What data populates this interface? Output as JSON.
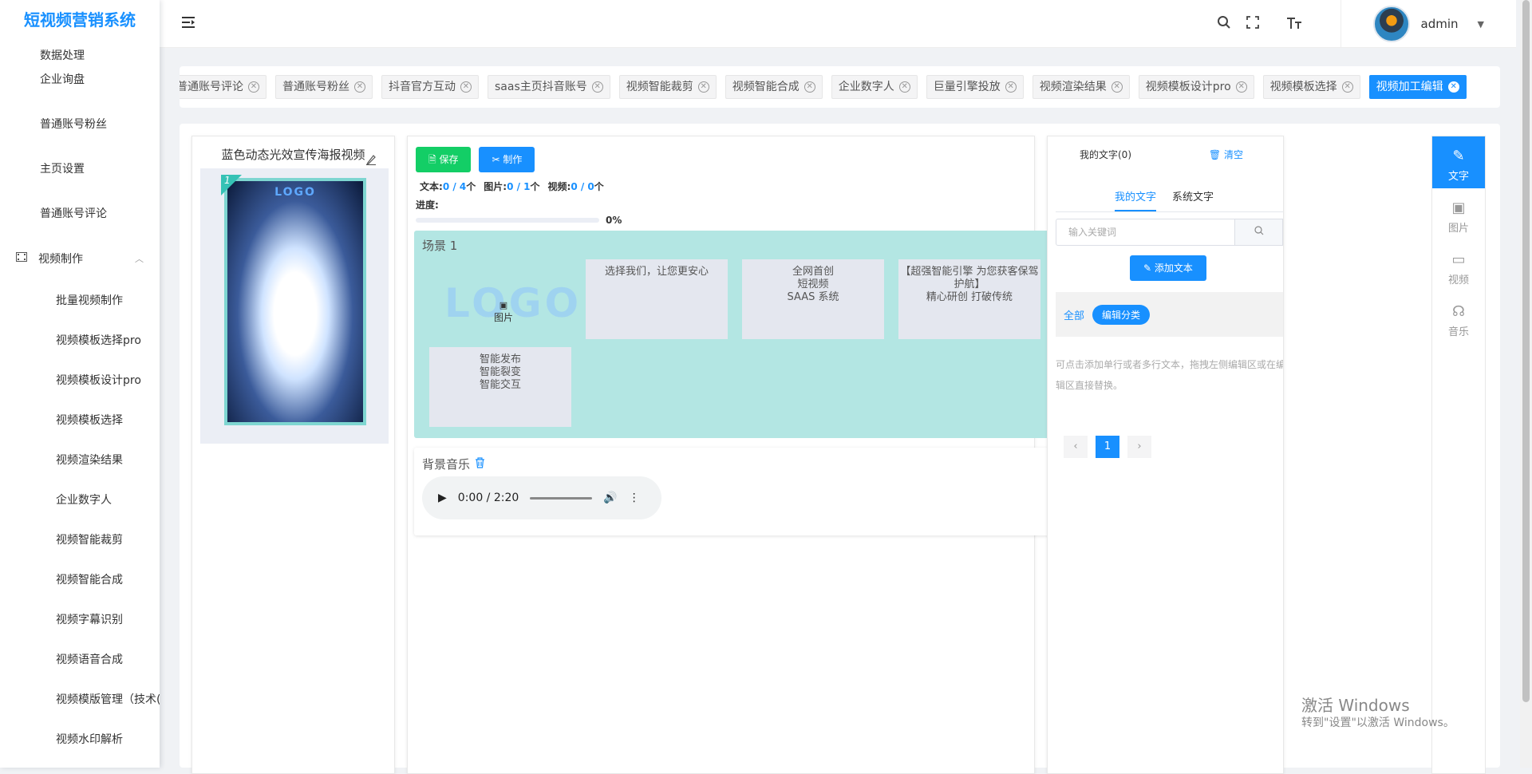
{
  "app": {
    "title": "短视频营销系统"
  },
  "sidebar": {
    "partial_item": "数据处理",
    "items": [
      {
        "label": "企业询盘"
      },
      {
        "label": "普通账号粉丝"
      },
      {
        "label": "主页设置"
      },
      {
        "label": "普通账号评论"
      }
    ],
    "group": {
      "label": "视频制作",
      "icon": "video-icon"
    },
    "sub_items": [
      {
        "label": "批量视频制作"
      },
      {
        "label": "视频模板选择pro"
      },
      {
        "label": "视频模板设计pro"
      },
      {
        "label": "视频模板选择"
      },
      {
        "label": "视频渲染结果"
      },
      {
        "label": "企业数字人"
      },
      {
        "label": "视频智能裁剪"
      },
      {
        "label": "视频智能合成"
      },
      {
        "label": "视频字幕识别"
      },
      {
        "label": "视频语音合成"
      },
      {
        "label": "视频模版管理（技术("
      },
      {
        "label": "视频水印解析"
      }
    ]
  },
  "header": {
    "username": "admin",
    "icons": [
      "search-icon",
      "fullscreen-icon",
      "font-size-icon"
    ]
  },
  "tags": [
    {
      "label": "普通账号评论",
      "active": false
    },
    {
      "label": "普通账号粉丝",
      "active": false
    },
    {
      "label": "抖音官方互动",
      "active": false
    },
    {
      "label": "saas主页抖音账号",
      "active": false
    },
    {
      "label": "视频智能裁剪",
      "active": false
    },
    {
      "label": "视频智能合成",
      "active": false
    },
    {
      "label": "企业数字人",
      "active": false
    },
    {
      "label": "巨量引擎投放",
      "active": false
    },
    {
      "label": "视频渲染结果",
      "active": false
    },
    {
      "label": "视频模板设计pro",
      "active": false
    },
    {
      "label": "视频模板选择",
      "active": false
    },
    {
      "label": "视频加工编辑",
      "active": true
    }
  ],
  "left_panel": {
    "title": "蓝色动态光效宣传海报视频",
    "thumb_number": "1",
    "thumb_logo": "LOGO"
  },
  "editor": {
    "save_label": "保存",
    "make_label": "制作",
    "stats": {
      "text_label": "文本:",
      "text_value": "0 / 4",
      "text_unit": "个",
      "image_label": "图片:",
      "image_value": "0 / 1",
      "image_unit": "个",
      "video_label": "视频:",
      "video_value": "0 / 0",
      "video_unit": "个"
    },
    "progress_label": "进度:",
    "progress_value": 0,
    "progress_text": "0%",
    "scene": {
      "title": "场景 1",
      "logo_text": "LOGO",
      "logo_caption": "图片",
      "cards": [
        "选择我们，让您更安心",
        "全网首创\n短视频\nSAAS 系统",
        "【超强智能引擎 为您获客保驾护航】\n精心研创 打破传统",
        "智能发布\n智能裂变\n智能交互"
      ]
    },
    "music": {
      "title": "背景音乐",
      "time": "0:00 / 2:20"
    }
  },
  "right_panel": {
    "my_text_count": "我的文字(0)",
    "clear_label": "清空",
    "tabs": [
      "我的文字",
      "系统文字"
    ],
    "search_placeholder": "输入关键词",
    "add_text_label": "添加文本",
    "cat_all": "全部",
    "cat_edit": "编辑分类",
    "hint": "可点击添加单行或者多行文本，拖拽左侧编辑区或在编辑区直接替换。",
    "page": "1"
  },
  "side_tools": [
    {
      "label": "文字",
      "icon": "pen-icon",
      "active": true
    },
    {
      "label": "图片",
      "icon": "image-icon",
      "active": false
    },
    {
      "label": "视频",
      "icon": "camera-icon",
      "active": false
    },
    {
      "label": "音乐",
      "icon": "headphones-icon",
      "active": false
    }
  ],
  "watermark": {
    "line1": "激活 Windows",
    "line2": "转到\"设置\"以激活 Windows。"
  },
  "colors": {
    "primary": "#1890ff",
    "success": "#13ce66",
    "scene_bg": "#b3e6e3"
  }
}
